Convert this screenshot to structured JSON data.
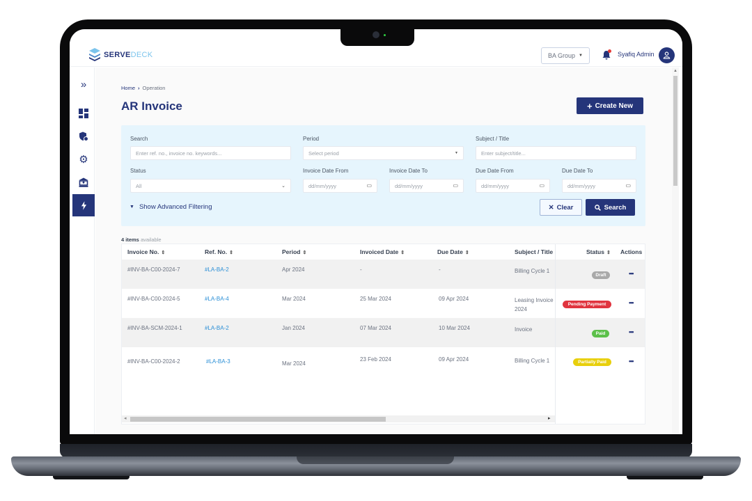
{
  "app": {
    "brand_primary": "SERVE",
    "brand_secondary": "DECK",
    "brand_color": "#25357a",
    "accent_color": "#7cc4ec"
  },
  "topbar": {
    "group_select": "BA Group",
    "user_name": "Syafiq Admin",
    "notification_icon": "bell-icon",
    "avatar_icon": "user-icon"
  },
  "sidebar": {
    "expand_icon": "double-chevron-right-icon",
    "items": [
      {
        "name": "dashboard",
        "icon": "dashboard-icon",
        "active": false
      },
      {
        "name": "security",
        "icon": "shield-icon",
        "active": false
      },
      {
        "name": "settings",
        "icon": "gear-icon",
        "active": false
      },
      {
        "name": "bank",
        "icon": "bank-icon",
        "active": false
      },
      {
        "name": "operation",
        "icon": "lightning-icon",
        "active": true
      }
    ]
  },
  "breadcrumb": [
    "Home",
    "Operation"
  ],
  "page": {
    "title": "AR Invoice",
    "create_button": "Create New"
  },
  "filters": {
    "search": {
      "label": "Search",
      "placeholder": "Enter ref. no., invoice no. keywords..."
    },
    "period": {
      "label": "Period",
      "placeholder": "Select period"
    },
    "subject": {
      "label": "Subject / Title",
      "placeholder": "Enter subject/title..."
    },
    "status": {
      "label": "Status",
      "value": "All"
    },
    "invoice_date_from": {
      "label": "Invoice Date From",
      "placeholder": "dd/mm/yyyy"
    },
    "invoice_date_to": {
      "label": "Invoice Date To",
      "placeholder": "dd/mm/yyyy"
    },
    "due_date_from": {
      "label": "Due Date From",
      "placeholder": "dd/mm/yyyy"
    },
    "due_date_to": {
      "label": "Due Date To",
      "placeholder": "dd/mm/yyyy"
    },
    "advanced_toggle": "Show Advanced Filtering",
    "clear_button": "Clear",
    "search_button": "Search"
  },
  "table": {
    "count_number": "4 items",
    "count_suffix": "available",
    "columns": [
      "Invoice No.",
      "Ref. No.",
      "Period",
      "Invoiced Date",
      "Due Date",
      "Subject / Title",
      "Status",
      "Actions"
    ],
    "rows": [
      {
        "invoice_no": "#INV-BA-C00-2024-7",
        "ref_no": "#LA-BA-2",
        "period": "Apr 2024",
        "invoiced_date": "-",
        "due_date": "-",
        "subject": "Billing Cycle 1",
        "status": "Draft",
        "status_color": "#a9a9a9",
        "actions": "•••"
      },
      {
        "invoice_no": "#INV-BA-C00-2024-5",
        "ref_no": "#LA-BA-4",
        "period": "Mar 2024",
        "invoiced_date": "25 Mar 2024",
        "due_date": "09 Apr 2024",
        "subject": "Leasing Invoice 2024",
        "status": "Pending Payment",
        "status_color": "#e0343f",
        "actions": "•••"
      },
      {
        "invoice_no": "#INV-BA-SCM-2024-1",
        "ref_no": "#LA-BA-2",
        "period": "Jan 2024",
        "invoiced_date": "07 Mar 2024",
        "due_date": "10 Mar 2024",
        "subject": "Invoice",
        "status": "Paid",
        "status_color": "#5cc04a",
        "actions": "•••"
      },
      {
        "invoice_no": "#INV-BA-C00-2024-2",
        "ref_no": "#LA-BA-3",
        "period": "Mar 2024",
        "invoiced_date": "23 Feb 2024",
        "due_date": "09 Apr 2024",
        "subject": "Billing Cycle 1",
        "status": "Partially Paid",
        "status_color": "#e8cf0c",
        "actions": "•••"
      }
    ]
  }
}
